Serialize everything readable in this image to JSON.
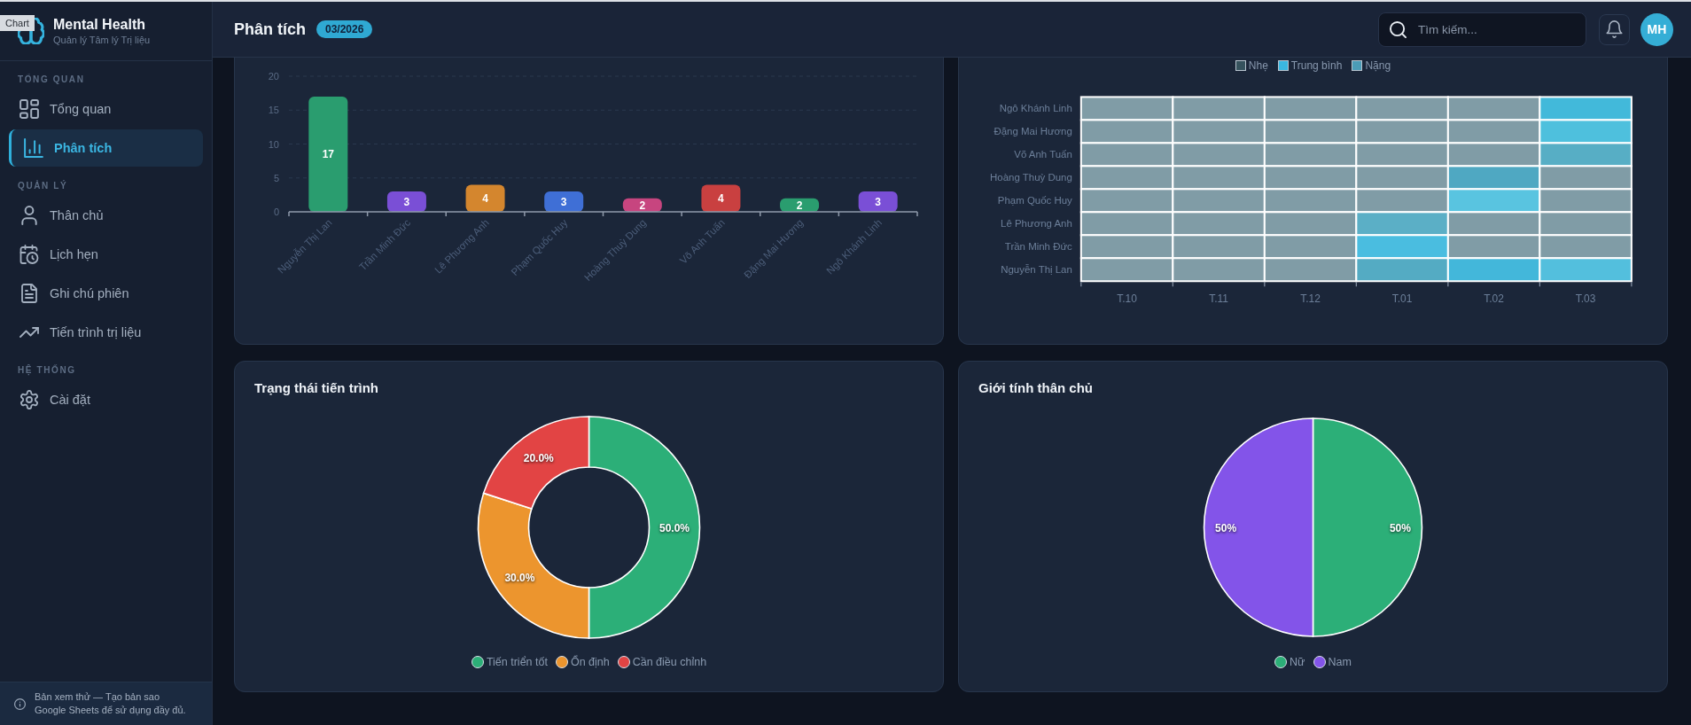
{
  "tooltip": "Chart",
  "sidebar": {
    "brand": {
      "title": "Mental Health",
      "subtitle": "Quản lý Tâm lý Trị liệu"
    },
    "sections": [
      {
        "title": "TỔNG QUAN",
        "items": [
          {
            "label": "Tổng quan",
            "selected": false
          },
          {
            "label": "Phân tích",
            "selected": true
          }
        ]
      },
      {
        "title": "QUẢN LÝ",
        "items": [
          {
            "label": "Thân chủ",
            "selected": false
          },
          {
            "label": "Lịch hẹn",
            "selected": false
          },
          {
            "label": "Ghi chú phiên",
            "selected": false
          },
          {
            "label": "Tiến trình trị liệu",
            "selected": false
          }
        ]
      },
      {
        "title": "HỆ THỐNG",
        "items": [
          {
            "label": "Cài đặt",
            "selected": false
          }
        ]
      }
    ],
    "notice": "Bản xem thử — Tạo bản sao Google Sheets để sử dụng đầy đủ."
  },
  "topbar": {
    "title": "Phân tích",
    "period_badge": "03/2026",
    "search": {
      "placeholder": "Tìm kiếm..."
    },
    "avatar": "MH"
  },
  "bar_chart_card": {
    "chart_data": {
      "type": "bar",
      "categories": [
        "Nguyễn Thị Lan",
        "Trần Minh Đức",
        "Lê Phương Anh",
        "Phạm Quốc Huy",
        "Hoàng Thuỳ Dung",
        "Võ Anh Tuấn",
        "Đặng Mai Hương",
        "Ngô Khánh Linh"
      ],
      "values": [
        17,
        3,
        4,
        3,
        2,
        4,
        2,
        3
      ],
      "colors": [
        "#2a9d6f",
        "#7a4fd6",
        "#d4862e",
        "#3f6fd6",
        "#c7457f",
        "#c94040",
        "#2a9d6f",
        "#7a4fd6"
      ],
      "ylim": [
        0,
        20
      ],
      "yticks": [
        0,
        5,
        10,
        15,
        20
      ],
      "grid": true,
      "data_labels": true
    }
  },
  "heatmap_card": {
    "legend": [
      {
        "label": "Nhẹ",
        "color": "#35525d"
      },
      {
        "label": "Trung bình",
        "color": "#3ab7e0"
      },
      {
        "label": "Nặng",
        "color": "#4b9cb7"
      }
    ],
    "columns": [
      "T.10",
      "T.11",
      "T.12",
      "T.01",
      "T.02",
      "T.03"
    ],
    "rows": [
      {
        "label": "Ngô Khánh Linh",
        "cells": [
          {
            "color": "#809ca6"
          },
          {
            "color": "#809ca6"
          },
          {
            "color": "#809ca6"
          },
          {
            "color": "#809ca6"
          },
          {
            "color": "#809ca6"
          },
          {
            "color": "#42b9da"
          }
        ]
      },
      {
        "label": "Đặng Mai Hương",
        "cells": [
          {
            "color": "#809ca6"
          },
          {
            "color": "#809ca6"
          },
          {
            "color": "#809ca6"
          },
          {
            "color": "#809ca6"
          },
          {
            "color": "#809ca6"
          },
          {
            "color": "#4ec0dd"
          }
        ]
      },
      {
        "label": "Võ Anh Tuấn",
        "cells": [
          {
            "color": "#809ca6"
          },
          {
            "color": "#809ca6"
          },
          {
            "color": "#809ca6"
          },
          {
            "color": "#809ca6"
          },
          {
            "color": "#809ca6"
          },
          {
            "color": "#57aec5"
          }
        ]
      },
      {
        "label": "Hoàng Thuỳ Dung",
        "cells": [
          {
            "color": "#809ca6"
          },
          {
            "color": "#809ca6"
          },
          {
            "color": "#809ca6"
          },
          {
            "color": "#809ca6"
          },
          {
            "color": "#4fa8c2"
          },
          {
            "color": "#809ca6"
          }
        ]
      },
      {
        "label": "Phạm Quốc Huy",
        "cells": [
          {
            "color": "#809ca6"
          },
          {
            "color": "#809ca6"
          },
          {
            "color": "#809ca6"
          },
          {
            "color": "#809ca6"
          },
          {
            "color": "#59c4e0"
          },
          {
            "color": "#809ca6"
          }
        ]
      },
      {
        "label": "Lê Phương Anh",
        "cells": [
          {
            "color": "#809ca6"
          },
          {
            "color": "#809ca6"
          },
          {
            "color": "#809ca6"
          },
          {
            "color": "#5bafc6"
          },
          {
            "color": "#809ca6"
          },
          {
            "color": "#809ca6"
          }
        ]
      },
      {
        "label": "Trần Minh Đức",
        "cells": [
          {
            "color": "#809ca6"
          },
          {
            "color": "#809ca6"
          },
          {
            "color": "#809ca6"
          },
          {
            "color": "#4abde0"
          },
          {
            "color": "#809ca6"
          },
          {
            "color": "#809ca6"
          }
        ]
      },
      {
        "label": "Nguyễn Thị Lan",
        "cells": [
          {
            "color": "#809ca6"
          },
          {
            "color": "#809ca6"
          },
          {
            "color": "#809ca6"
          },
          {
            "color": "#54abc3"
          },
          {
            "color": "#43b7da"
          },
          {
            "color": "#53bfdd"
          }
        ]
      }
    ]
  },
  "progress_card": {
    "title": "Trạng thái tiến trình",
    "chart_data": {
      "type": "donut",
      "categories": [
        "Tiến triển tốt",
        "Ổn định",
        "Cần điều chỉnh"
      ],
      "values": [
        50,
        30,
        20
      ],
      "colors": [
        "#2caf78",
        "#ec952e",
        "#e24444"
      ],
      "value_labels": [
        "50.0%",
        "30.0%",
        "20.0%"
      ]
    }
  },
  "gender_card": {
    "title": "Giới tính thân chủ",
    "chart_data": {
      "type": "pie",
      "categories": [
        "Nữ",
        "Nam"
      ],
      "values": [
        50,
        50
      ],
      "colors": [
        "#2caf78",
        "#8354e9"
      ],
      "value_labels": [
        "50%",
        "50%"
      ]
    }
  }
}
